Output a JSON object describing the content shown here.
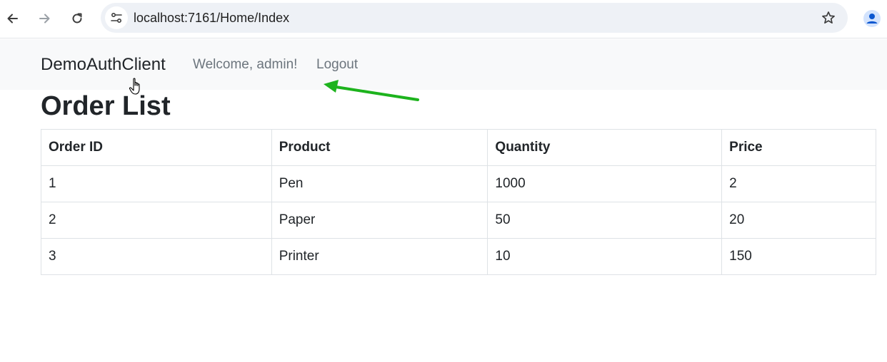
{
  "browser": {
    "url": "localhost:7161/Home/Index",
    "back_icon": "arrow-left-icon",
    "forward_icon": "arrow-right-icon",
    "reload_icon": "reload-icon",
    "site_info_icon": "tune-icon",
    "bookmark_icon": "star-icon",
    "profile_icon": "person-icon",
    "profile_color": "#0b57d0"
  },
  "navbar": {
    "brand": "DemoAuthClient",
    "welcome": "Welcome, admin!",
    "logout": "Logout"
  },
  "annotation": {
    "arrow_color": "#1db31d"
  },
  "main": {
    "title": "Order List",
    "columns": [
      "Order ID",
      "Product",
      "Quantity",
      "Price"
    ],
    "rows": [
      [
        "1",
        "Pen",
        "1000",
        "2"
      ],
      [
        "2",
        "Paper",
        "50",
        "20"
      ],
      [
        "3",
        "Printer",
        "10",
        "150"
      ]
    ]
  }
}
